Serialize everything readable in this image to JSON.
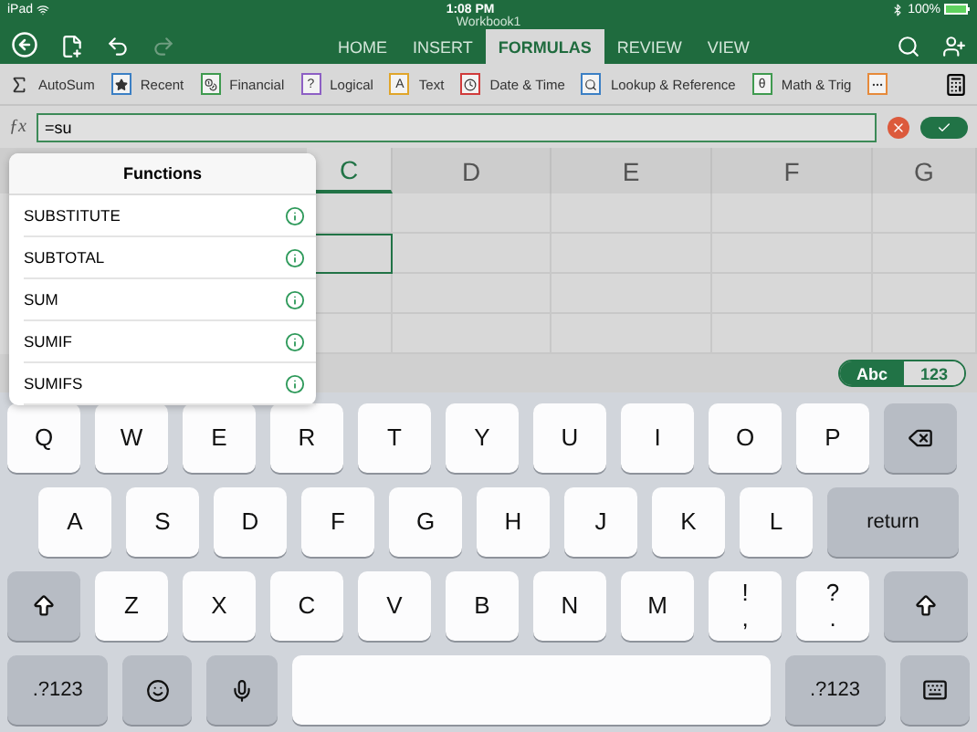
{
  "status_bar": {
    "device": "iPad",
    "time": "1:08 PM",
    "battery": "100%"
  },
  "window": {
    "title": "Workbook1"
  },
  "tabs": [
    {
      "label": "HOME",
      "selected": false
    },
    {
      "label": "INSERT",
      "selected": false
    },
    {
      "label": "FORMULAS",
      "selected": true
    },
    {
      "label": "REVIEW",
      "selected": false
    },
    {
      "label": "VIEW",
      "selected": false
    }
  ],
  "ribbon": [
    {
      "label": "AutoSum",
      "kind": "sum"
    },
    {
      "label": "Recent",
      "kind": "star",
      "color": "#3b7fc4"
    },
    {
      "label": "Financial",
      "kind": "coins",
      "color": "#3f9a4f"
    },
    {
      "label": "Logical",
      "kind": "question",
      "color": "#8d5fc4",
      "glyph": "?"
    },
    {
      "label": "Text",
      "kind": "text",
      "color": "#e0a52a",
      "glyph": "A"
    },
    {
      "label": "Date & Time",
      "kind": "clock",
      "color": "#d03b3b"
    },
    {
      "label": "Lookup & Reference",
      "kind": "search",
      "color": "#3b7fc4"
    },
    {
      "label": "Math & Trig",
      "kind": "theta",
      "color": "#3f9a4f",
      "glyph": "θ"
    },
    {
      "kind": "more",
      "color": "#e68a3a"
    }
  ],
  "formula_bar": {
    "label": "ƒx",
    "value": "=su"
  },
  "functions_popup": {
    "title": "Functions",
    "items": [
      "SUBSTITUTE",
      "SUBTOTAL",
      "SUM",
      "SUMIF",
      "SUMIFS"
    ]
  },
  "grid": {
    "columns": [
      {
        "label": "C",
        "selected": true
      },
      {
        "label": "D",
        "selected": false
      },
      {
        "label": "E",
        "selected": false
      },
      {
        "label": "F",
        "selected": false
      },
      {
        "label": "G",
        "selected": false
      }
    ],
    "rows": [
      {
        "selected": false
      },
      {
        "selected": true
      },
      {
        "selected": false
      },
      {
        "selected": false
      }
    ]
  },
  "keyboard_toggle": [
    {
      "label": "Abc",
      "selected": true
    },
    {
      "label": "123",
      "selected": false
    }
  ],
  "keyboard": [
    [
      {
        "kind": "letter",
        "label": "Q"
      },
      {
        "kind": "letter",
        "label": "W"
      },
      {
        "kind": "letter",
        "label": "E"
      },
      {
        "kind": "letter",
        "label": "R"
      },
      {
        "kind": "letter",
        "label": "T"
      },
      {
        "kind": "letter",
        "label": "Y"
      },
      {
        "kind": "letter",
        "label": "U"
      },
      {
        "kind": "letter",
        "label": "I"
      },
      {
        "kind": "letter",
        "label": "O"
      },
      {
        "kind": "letter",
        "label": "P"
      },
      {
        "kind": "backspace"
      }
    ],
    [
      {
        "kind": "letter",
        "label": "A"
      },
      {
        "kind": "letter",
        "label": "S"
      },
      {
        "kind": "letter",
        "label": "D"
      },
      {
        "kind": "letter",
        "label": "F"
      },
      {
        "kind": "letter",
        "label": "G"
      },
      {
        "kind": "letter",
        "label": "H"
      },
      {
        "kind": "letter",
        "label": "J"
      },
      {
        "kind": "letter",
        "label": "K"
      },
      {
        "kind": "letter",
        "label": "L"
      },
      {
        "kind": "return",
        "label": "return"
      }
    ],
    [
      {
        "kind": "shift"
      },
      {
        "kind": "letter",
        "label": "Z"
      },
      {
        "kind": "letter",
        "label": "X"
      },
      {
        "kind": "letter",
        "label": "C"
      },
      {
        "kind": "letter",
        "label": "V"
      },
      {
        "kind": "letter",
        "label": "B"
      },
      {
        "kind": "letter",
        "label": "N"
      },
      {
        "kind": "letter",
        "label": "M"
      },
      {
        "kind": "punct",
        "top": "!",
        "bottom": ","
      },
      {
        "kind": "punct",
        "top": "?",
        "bottom": "."
      },
      {
        "kind": "shift"
      }
    ],
    [
      {
        "kind": "mode",
        "label": ".?123"
      },
      {
        "kind": "emoji"
      },
      {
        "kind": "mic"
      },
      {
        "kind": "space"
      },
      {
        "kind": "mode",
        "label": ".?123"
      },
      {
        "kind": "hide"
      }
    ]
  ]
}
